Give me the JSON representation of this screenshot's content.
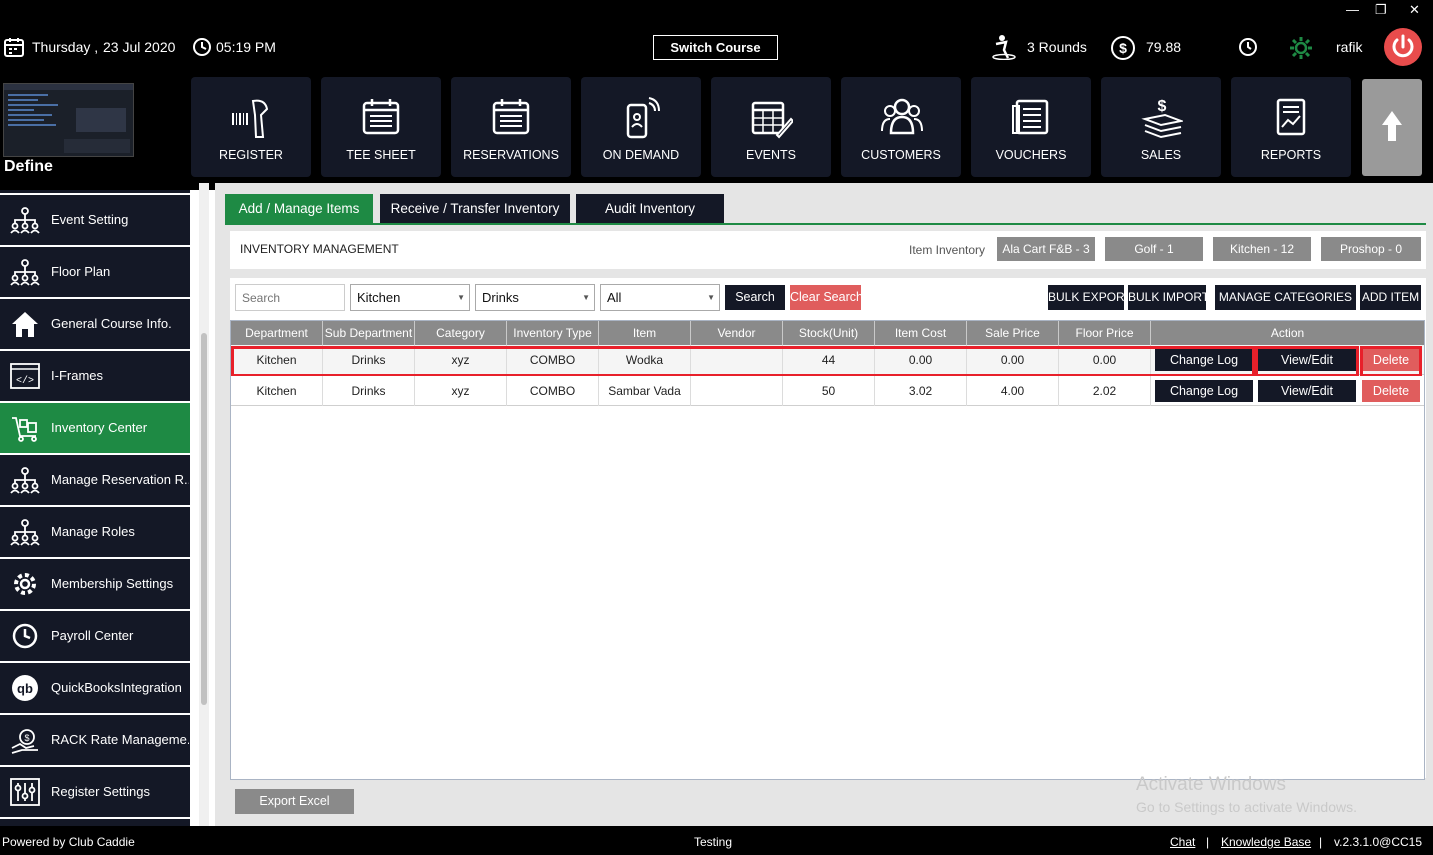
{
  "window_controls": {
    "minimize": "—",
    "maximize": "❐",
    "close": "✕"
  },
  "header": {
    "day": "Thursday ,",
    "date": "23 Jul 2020",
    "time": "05:19 PM",
    "switch_course": "Switch Course",
    "rounds": "3 Rounds",
    "balance": "79.88",
    "user": "rafik"
  },
  "define": {
    "label": "Define"
  },
  "nav": [
    {
      "label": "REGISTER",
      "icon": "barcode-scanner-icon"
    },
    {
      "label": "TEE SHEET",
      "icon": "tee-sheet-icon"
    },
    {
      "label": "RESERVATIONS",
      "icon": "reservations-icon"
    },
    {
      "label": "ON DEMAND",
      "icon": "mobile-phone-icon"
    },
    {
      "label": "EVENTS",
      "icon": "calendar-edit-icon"
    },
    {
      "label": "CUSTOMERS",
      "icon": "customers-icon"
    },
    {
      "label": "VOUCHERS",
      "icon": "vouchers-icon"
    },
    {
      "label": "SALES",
      "icon": "sales-icon"
    },
    {
      "label": "REPORTS",
      "icon": "reports-icon"
    }
  ],
  "sidebar": {
    "items": [
      {
        "label": "Event Setting",
        "icon": "org-chart-icon"
      },
      {
        "label": "Floor Plan",
        "icon": "org-chart-icon"
      },
      {
        "label": "General Course Info.",
        "icon": "home-icon"
      },
      {
        "label": "I-Frames",
        "icon": "code-icon"
      },
      {
        "label": "Inventory Center",
        "icon": "inventory-icon",
        "active": true
      },
      {
        "label": "Manage Reservation R...",
        "icon": "org-chart-icon"
      },
      {
        "label": "Manage Roles",
        "icon": "org-chart-icon"
      },
      {
        "label": "Membership Settings",
        "icon": "gear-icon"
      },
      {
        "label": "Payroll Center",
        "icon": "clock-icon"
      },
      {
        "label": "QuickBooksIntegration",
        "icon": "quickbooks-icon"
      },
      {
        "label": "RACK Rate Manageme...",
        "icon": "rate-icon"
      },
      {
        "label": "Register Settings",
        "icon": "sliders-icon"
      }
    ]
  },
  "tabs": [
    {
      "label": "Add / Manage Items",
      "active": true
    },
    {
      "label": "Receive / Transfer Inventory"
    },
    {
      "label": "Audit Inventory"
    }
  ],
  "inventory": {
    "title": "INVENTORY MANAGEMENT",
    "item_inventory_label": "Item Inventory",
    "badges": [
      "Ala Cart F&B - 3",
      "Golf - 1",
      "Kitchen - 12",
      "Proshop - 0"
    ]
  },
  "filters": {
    "search_placeholder": "Search",
    "department": "Kitchen",
    "sub_department": "Drinks",
    "category": "All",
    "search_button": "Search",
    "clear_button": "Clear Search",
    "bulk_export": "BULK EXPORT",
    "bulk_import": "BULK IMPORT",
    "manage_categories": "MANAGE CATEGORIES",
    "add_item": "ADD ITEM"
  },
  "table": {
    "columns": [
      "Department",
      "Sub Department",
      "Category",
      "Inventory Type",
      "Item",
      "Vendor",
      "Stock(Unit)",
      "Item Cost",
      "Sale Price",
      "Floor Price",
      "Action"
    ],
    "action_labels": {
      "change_log": "Change Log",
      "view_edit": "View/Edit",
      "delete": "Delete"
    },
    "rows": [
      [
        "Kitchen",
        "Drinks",
        "xyz",
        "COMBO",
        "Wodka",
        "",
        "44",
        "0.00",
        "0.00",
        "0.00"
      ],
      [
        "Kitchen",
        "Drinks",
        "xyz",
        "COMBO",
        "Sambar Vada",
        "",
        "50",
        "3.02",
        "4.00",
        "2.02"
      ]
    ]
  },
  "export_excel": "Export Excel",
  "watermark": {
    "line1": "Activate Windows",
    "line2": "Go to Settings to activate Windows."
  },
  "footer": {
    "powered_by": "Powered by Club Caddie",
    "environment": "Testing",
    "chat": "Chat",
    "separator": "|",
    "knowledge_base": "Knowledge Base",
    "version": "v.2.3.1.0@CC15"
  },
  "colors": {
    "accent_green": "#1e8a44",
    "dark_tile": "#141826",
    "danger": "#e05d5d",
    "highlight": "#e8202a"
  }
}
